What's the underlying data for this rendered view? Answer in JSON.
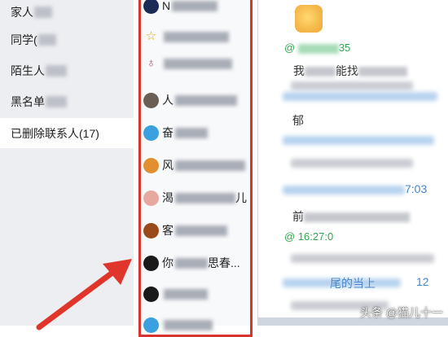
{
  "groups": [
    {
      "label": "家人",
      "mask_w": 22
    },
    {
      "label": "同学(",
      "mask_w": 22
    },
    {
      "label": "陌生人",
      "mask_w": 26
    },
    {
      "label": "黑名单",
      "mask_w": 26
    },
    {
      "label": "已删除联系人(17)",
      "mask_w": 0
    }
  ],
  "contacts": [
    {
      "name": "N",
      "mask_w": 56,
      "avatar": "avatar-icon",
      "color": "#1b2a57",
      "glyph": ""
    },
    {
      "name": "",
      "mask_w": 80,
      "avatar": "star-icon",
      "color": "#ffffff",
      "glyph": "☆"
    },
    {
      "name": "",
      "mask_w": 84,
      "avatar": "figure-icon",
      "color": "#ffffff",
      "glyph": "♁"
    },
    {
      "name": "人",
      "mask_w": 76,
      "avatar": "person-photo-icon",
      "color": "#6a5e55",
      "glyph": ""
    },
    {
      "name": "奋",
      "mask_w": 40,
      "avatar": "globe-icon",
      "color": "#3aa0e0",
      "glyph": ""
    },
    {
      "name": "风",
      "mask_w": 86,
      "avatar": "avatar-icon",
      "color": "#e2902f",
      "glyph": ""
    },
    {
      "name": "渴",
      "mask_w": 74,
      "avatar": "girl-avatar-icon",
      "color": "#e7a8a0",
      "glyph": ""
    },
    {
      "name": "客",
      "mask_w": 64,
      "avatar": "avatar-icon",
      "color": "#9a4a1a",
      "glyph": ""
    },
    {
      "name": "你",
      "mask_w": 40,
      "avatar": "qq-penguin-icon",
      "color": "#1a1a1a",
      "glyph": ""
    },
    {
      "name": "",
      "mask_w": 54,
      "avatar": "qq-penguin-icon",
      "color": "#1a1a1a",
      "glyph": ""
    },
    {
      "name": "",
      "mask_w": 60,
      "avatar": "globe-icon",
      "color": "#3aa0e0",
      "glyph": ""
    }
  ],
  "contact_suffixes": [
    "",
    "",
    "",
    "",
    "",
    "",
    "儿",
    "",
    "思春...",
    "",
    ""
  ],
  "chat": {
    "timestamp_1_suffix": "35",
    "timestamp_1_prefix": "@",
    "message_1_prefix": "我",
    "message_1_mid": "能",
    "message_1_mid2": "找",
    "timestamp_2_prefix": "@",
    "timestamp_2": "16:27:0",
    "time_fragment_1": "7:03",
    "number_fragment": "12",
    "text_fragment_a": "郁",
    "text_fragment_b": "前",
    "text_fragment_c": "尾的当上"
  },
  "watermark": "头条 @猫儿十一",
  "colors": {
    "highlight_frame": "#d8352f",
    "arrow": "#e0352a",
    "timestamp": "#2fa84f",
    "selected_row": "#ffffff"
  }
}
